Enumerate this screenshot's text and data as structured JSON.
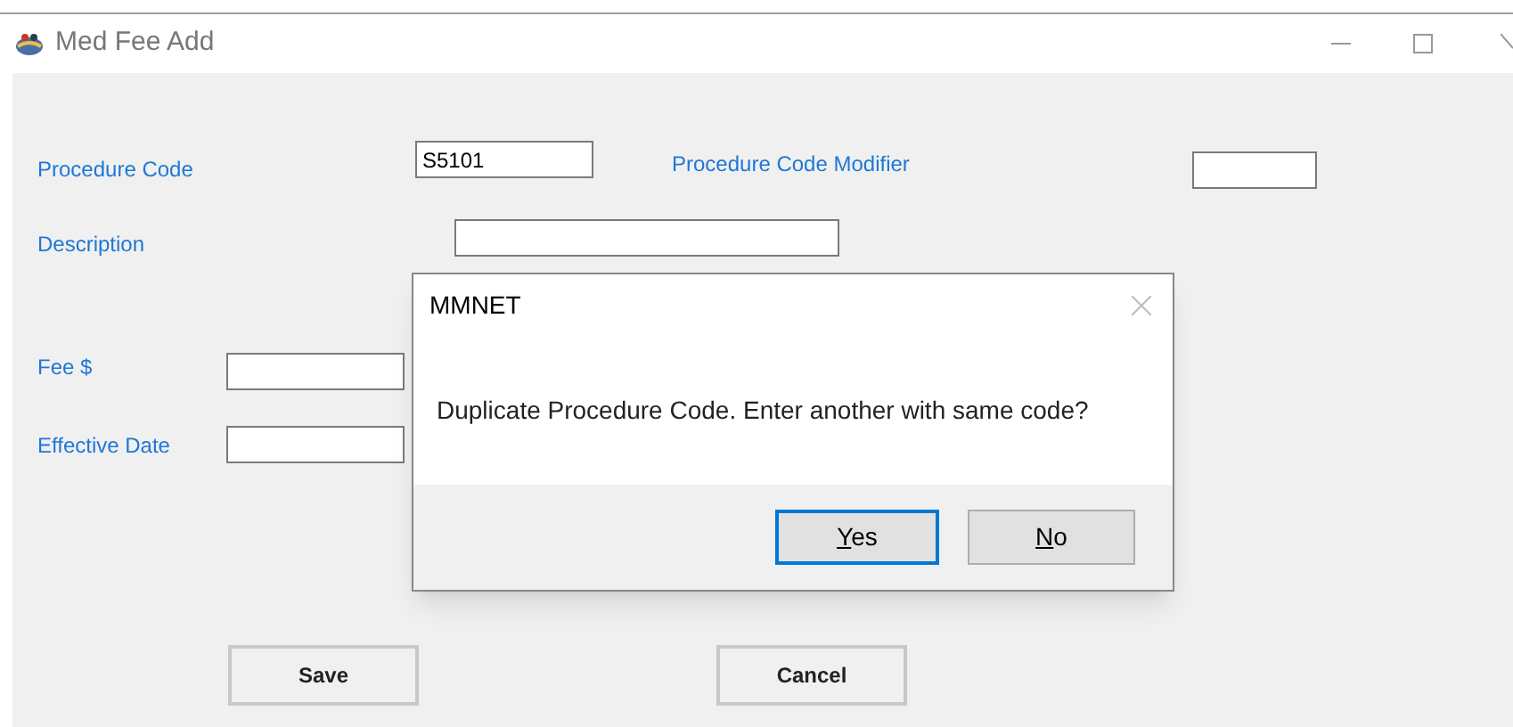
{
  "window": {
    "title": "Med Fee Add"
  },
  "fields": [
    {
      "label": "Procedure Code",
      "value": "S5101"
    },
    {
      "label": "Procedure Code Modifier"
    },
    {
      "label": "Description"
    },
    {
      "label": "Fee $"
    },
    {
      "label": "Effective Date"
    }
  ],
  "buttons": [
    {
      "label": "Save"
    },
    {
      "label": "Cancel"
    }
  ],
  "dialog": {
    "title": "MMNET",
    "message": "Duplicate Procedure Code. Enter another with same code?",
    "buttons": [
      {
        "label": "Yes",
        "selected": true,
        "underline_first": true
      },
      {
        "label": "No",
        "selected": false,
        "underline_first": true
      }
    ]
  }
}
